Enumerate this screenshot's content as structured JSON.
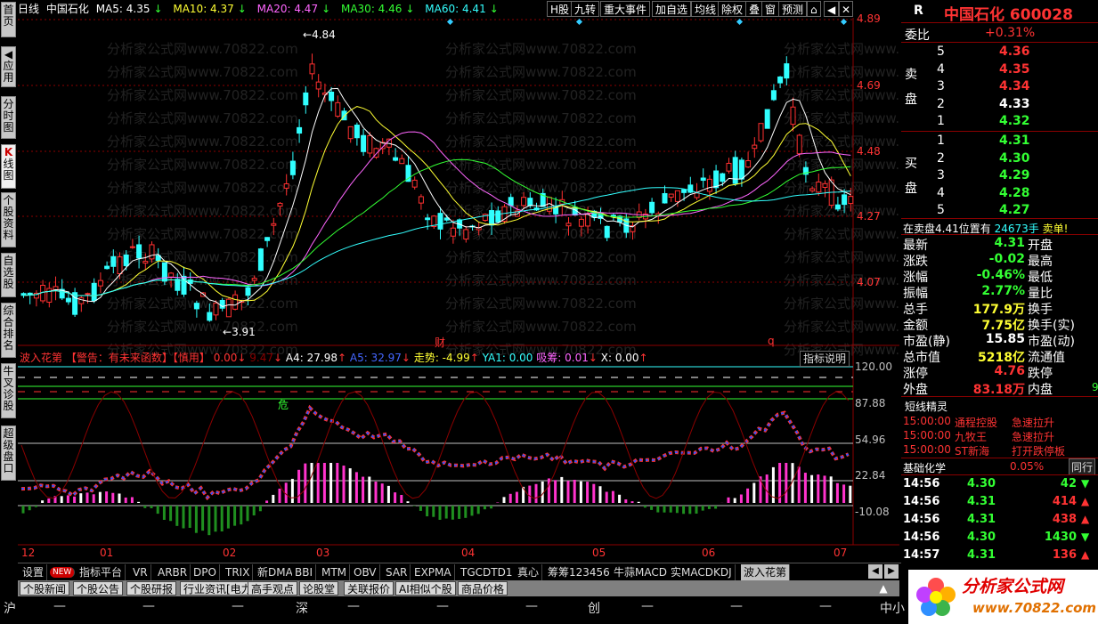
{
  "sidebar": {
    "tabs": [
      {
        "label": "首页"
      },
      {
        "label": "应用"
      },
      {
        "label": "分时图"
      },
      {
        "label": "线图",
        "prefix": "K"
      },
      {
        "label": "个股资料"
      },
      {
        "label": "自选股"
      },
      {
        "label": "综合排名"
      },
      {
        "label": "牛叉诊股"
      },
      {
        "label": "超级盘口"
      }
    ]
  },
  "topbar": {
    "period": "日线",
    "stock_name": "中国石化",
    "ma5": "MA5: 4.35",
    "ma10": "MA10: 4.37",
    "ma20": "MA20: 4.47",
    "ma30": "MA30: 4.46",
    "ma60": "MA60: 4.41",
    "buttons": [
      "H股",
      "九转",
      "重大事件",
      "加自选",
      "均线",
      "除权",
      "叠",
      "窗",
      "预测"
    ]
  },
  "main_chart": {
    "price_axis": [
      "4.89",
      "4.69",
      "4.48",
      "4.27",
      "4.07"
    ],
    "high_label": "4.84",
    "low_label": "3.91",
    "markers": [
      "财",
      "q"
    ],
    "watermark": "分析家公式网www.70822.com"
  },
  "indicator": {
    "title": "波入花第",
    "warning": "【警告：有未来函数】【慎用】",
    "v0": "0.00",
    "v1": "9.47",
    "a4": "A4: 27.98",
    "a5": "A5: 32.97",
    "trend": "走势: -4.99",
    "ya1": "YA1: 0.00",
    "absorb": "吸筹: 0.01",
    "x": "X: 0.00",
    "help_button": "指标说明",
    "danger": "危",
    "axis": [
      "120.00",
      "87.88",
      "54.96",
      "22.84",
      "-10.08"
    ]
  },
  "time_axis": [
    "12",
    "01",
    "02",
    "03",
    "04",
    "05",
    "06",
    "07"
  ],
  "right_panel": {
    "header_r": "R",
    "name": "中国石化",
    "code": "600028",
    "weibi_label": "委比",
    "weibi": "+0.31%",
    "sell_label": "卖盘",
    "sells": [
      {
        "n": "5",
        "p": "4.36"
      },
      {
        "n": "4",
        "p": "4.35"
      },
      {
        "n": "3",
        "p": "4.34"
      },
      {
        "n": "2",
        "p": "4.33"
      },
      {
        "n": "1",
        "p": "4.32"
      }
    ],
    "buy_label": "买盘",
    "buys": [
      {
        "n": "1",
        "p": "4.31"
      },
      {
        "n": "2",
        "p": "4.30"
      },
      {
        "n": "3",
        "p": "4.29"
      },
      {
        "n": "4",
        "p": "4.28"
      },
      {
        "n": "5",
        "p": "4.27"
      }
    ],
    "notice": "在卖盘4.41位置有",
    "notice_qty": "24673手",
    "notice_tail": "卖单!",
    "stats": [
      {
        "l": "最新",
        "v": "4.31",
        "c": "green",
        "r": "开盘"
      },
      {
        "l": "涨跌",
        "v": "-0.02",
        "c": "green",
        "r": "最高"
      },
      {
        "l": "涨幅",
        "v": "-0.46%",
        "c": "green",
        "r": "最低"
      },
      {
        "l": "振幅",
        "v": "2.77%",
        "c": "green",
        "r": "量比"
      },
      {
        "l": "总手",
        "v": "177.9万",
        "c": "yel",
        "r": "换手"
      },
      {
        "l": "金额",
        "v": "7.75亿",
        "c": "yel",
        "r": "换手(实)"
      },
      {
        "l": "市盈(静)",
        "v": "15.85",
        "c": "white",
        "r": "市盈(动)"
      },
      {
        "l": "总市值",
        "v": "5218亿",
        "c": "yel",
        "r": "流通值"
      },
      {
        "l": "涨停",
        "v": "4.76",
        "c": "red",
        "r": "跌停"
      },
      {
        "l": "外盘",
        "v": "83.18万",
        "c": "red",
        "r": "内盘"
      }
    ],
    "inner_tail": "9",
    "genie_title": "短线精灵",
    "genie_rows": [
      {
        "t": "15:00:00",
        "n": "通程控股",
        "e": "急速拉升"
      },
      {
        "t": "15:00:00",
        "n": "九牧王",
        "e": "急速拉升"
      },
      {
        "t": "15:00:00",
        "n": "ST新海",
        "e": "打开跌停板"
      }
    ],
    "fund_label": "基础化学",
    "fund_value": "0.05%",
    "fund_tab": "同行",
    "ticks": [
      {
        "t": "14:56",
        "p": "4.30",
        "v": "42",
        "d": "down"
      },
      {
        "t": "14:56",
        "p": "4.31",
        "v": "414",
        "d": "up"
      },
      {
        "t": "14:56",
        "p": "4.31",
        "v": "438",
        "d": "up"
      },
      {
        "t": "14:56",
        "p": "4.30",
        "v": "1430",
        "d": "down"
      },
      {
        "t": "14:57",
        "p": "4.31",
        "v": "136",
        "d": "up"
      }
    ]
  },
  "tabs": [
    "设置",
    "NEW",
    "指标平台",
    "VR",
    "ARBR",
    "DPO",
    "TRIX",
    "新DMA",
    "BBI",
    "MTM",
    "OBV",
    "SAR",
    "EXPMA",
    "TGCDTD1",
    "真心",
    "筹筹123456",
    "牛蒜MACD",
    "实MACDKDJ",
    "波入花第"
  ],
  "bottom_tabs": [
    "个股新闻",
    "个股公告",
    "个股研报",
    "行业资讯[电力]",
    "高手观点",
    "论股堂",
    "关联报价",
    "AI相似个股",
    "商品价格"
  ],
  "status": {
    "sh": "沪",
    "sz": "深",
    "cy": "创",
    "zx": "中小",
    "dash": "—"
  },
  "logo": {
    "name": "分析家公式网",
    "url": "www.70822.com"
  }
}
